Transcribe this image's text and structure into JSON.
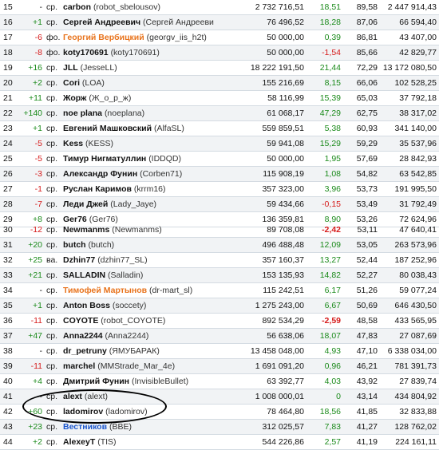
{
  "table_top": {
    "rows": [
      {
        "num": "15",
        "chg": "-",
        "chg_cls": "",
        "type": "ср.",
        "nick": "carbon",
        "nick_cls": "",
        "login": "(robot_sbelousov)",
        "amount": "2 732 716,51",
        "pct": "18,51",
        "pct_cls": "pos",
        "p2": "89,58",
        "total": "2 447 914,43"
      },
      {
        "num": "16",
        "chg": "+1",
        "chg_cls": "pos",
        "type": "ср.",
        "nick": "Сергей Андреевич",
        "nick_cls": "",
        "login": "(Сергей Андрееви",
        "amount": "76 496,52",
        "pct": "18,28",
        "pct_cls": "pos",
        "p2": "87,06",
        "total": "66 594,40"
      },
      {
        "num": "17",
        "chg": "-6",
        "chg_cls": "neg",
        "type": "фо.",
        "nick": "Георгий Вербицкий",
        "nick_cls": "orange",
        "login": "(georgv_iis_h2t)",
        "amount": "50 000,00",
        "pct": "0,39",
        "pct_cls": "pos",
        "p2": "86,81",
        "total": "43 407,00"
      },
      {
        "num": "18",
        "chg": "-8",
        "chg_cls": "neg",
        "type": "фо.",
        "nick": "koty170691",
        "nick_cls": "",
        "login": "(koty170691)",
        "amount": "50 000,00",
        "pct": "-1,54",
        "pct_cls": "neg",
        "p2": "85,66",
        "total": "42 829,77"
      },
      {
        "num": "19",
        "chg": "+16",
        "chg_cls": "pos",
        "type": "ср.",
        "nick": "JLL",
        "nick_cls": "",
        "login": "(JesseLL)",
        "amount": "18 222 191,50",
        "pct": "21,44",
        "pct_cls": "pos",
        "p2": "72,29",
        "total": "13 172 080,50"
      },
      {
        "num": "20",
        "chg": "+2",
        "chg_cls": "pos",
        "type": "ср.",
        "nick": "Cori",
        "nick_cls": "",
        "login": "(LOA)",
        "amount": "155 216,69",
        "pct": "8,15",
        "pct_cls": "pos",
        "p2": "66,06",
        "total": "102 528,25"
      },
      {
        "num": "21",
        "chg": "+11",
        "chg_cls": "pos",
        "type": "ср.",
        "nick": "Жорж",
        "nick_cls": "",
        "login": "(Ж_о_р_ж)",
        "amount": "58 116,99",
        "pct": "15,39",
        "pct_cls": "pos",
        "p2": "65,03",
        "total": "37 792,18"
      },
      {
        "num": "22",
        "chg": "+140",
        "chg_cls": "pos",
        "type": "ср.",
        "nick": "noe plana",
        "nick_cls": "",
        "login": "(noeplana)",
        "amount": "61 068,17",
        "pct": "47,29",
        "pct_cls": "pos",
        "p2": "62,75",
        "total": "38 317,02"
      },
      {
        "num": "23",
        "chg": "+1",
        "chg_cls": "pos",
        "type": "ср.",
        "nick": "Евгений Машковский",
        "nick_cls": "",
        "login": "(AlfaSL)",
        "amount": "559 859,51",
        "pct": "5,38",
        "pct_cls": "pos",
        "p2": "60,93",
        "total": "341 140,00"
      },
      {
        "num": "24",
        "chg": "-5",
        "chg_cls": "neg",
        "type": "ср.",
        "nick": "Kess",
        "nick_cls": "",
        "login": "(KESS)",
        "amount": "59 941,08",
        "pct": "15,29",
        "pct_cls": "pos",
        "p2": "59,29",
        "total": "35 537,96"
      },
      {
        "num": "25",
        "chg": "-5",
        "chg_cls": "neg",
        "type": "ср.",
        "nick": "Тимур Нигматуллин",
        "nick_cls": "",
        "login": "(IDDQD)",
        "amount": "50 000,00",
        "pct": "1,95",
        "pct_cls": "pos",
        "p2": "57,69",
        "total": "28 842,93"
      },
      {
        "num": "26",
        "chg": "-3",
        "chg_cls": "neg",
        "type": "ср.",
        "nick": "Александр Фунин",
        "nick_cls": "",
        "login": "(Corben71)",
        "amount": "115 908,19",
        "pct": "1,08",
        "pct_cls": "pos",
        "p2": "54,82",
        "total": "63 542,85"
      },
      {
        "num": "27",
        "chg": "-1",
        "chg_cls": "neg",
        "type": "ср.",
        "nick": "Руслан Каримов",
        "nick_cls": "",
        "login": "(krrm16)",
        "amount": "357 323,00",
        "pct": "3,96",
        "pct_cls": "pos",
        "p2": "53,73",
        "total": "191 995,50"
      },
      {
        "num": "28",
        "chg": "-7",
        "chg_cls": "neg",
        "type": "ср.",
        "nick": "Леди Джей",
        "nick_cls": "",
        "login": "(Lady_Jaye)",
        "amount": "59 434,66",
        "pct": "-0,15",
        "pct_cls": "neg",
        "p2": "53,49",
        "total": "31 792,49"
      },
      {
        "num": "29",
        "chg": "+8",
        "chg_cls": "pos",
        "type": "ср.",
        "nick": "Ger76",
        "nick_cls": "",
        "login": "(Ger76)",
        "amount": "136 359,81",
        "pct": "8,90",
        "pct_cls": "pos",
        "p2": "53,26",
        "total": "72 624,96"
      }
    ]
  },
  "table_bottom": {
    "rows": [
      {
        "num": "30",
        "chg": "-12",
        "chg_cls": "neg",
        "type": "ср.",
        "nick": "Newmanms",
        "nick_cls": "",
        "login": "(Newmanms)",
        "amount": "89 708,08",
        "pct": "-2,42",
        "pct_cls": "redb",
        "p2": "53,11",
        "total": "47 640,41"
      },
      {
        "num": "31",
        "chg": "+20",
        "chg_cls": "pos",
        "type": "ср.",
        "nick": "butch",
        "nick_cls": "",
        "login": "(butch)",
        "amount": "496 488,48",
        "pct": "12,09",
        "pct_cls": "pos",
        "p2": "53,05",
        "total": "263 573,96"
      },
      {
        "num": "32",
        "chg": "+25",
        "chg_cls": "pos",
        "type": "ва.",
        "nick": "Dzhin77",
        "nick_cls": "",
        "login": "(dzhin77_SL)",
        "amount": "357 160,37",
        "pct": "13,27",
        "pct_cls": "pos",
        "p2": "52,44",
        "total": "187 252,96"
      },
      {
        "num": "33",
        "chg": "+21",
        "chg_cls": "pos",
        "type": "ср.",
        "nick": "SALLADIN",
        "nick_cls": "",
        "login": "(Salladin)",
        "amount": "153 135,93",
        "pct": "14,82",
        "pct_cls": "pos",
        "p2": "52,27",
        "total": "80 038,43"
      },
      {
        "num": "34",
        "chg": "-",
        "chg_cls": "",
        "type": "ср.",
        "nick": "Тимофей Мартынов",
        "nick_cls": "orange",
        "login": "(dr-mart_sl)",
        "amount": "115 242,51",
        "pct": "6,17",
        "pct_cls": "pos",
        "p2": "51,26",
        "total": "59 077,24"
      },
      {
        "num": "35",
        "chg": "+1",
        "chg_cls": "pos",
        "type": "ср.",
        "nick": "Anton Boss",
        "nick_cls": "",
        "login": "(soccety)",
        "amount": "1 275 243,00",
        "pct": "6,67",
        "pct_cls": "pos",
        "p2": "50,69",
        "total": "646 430,50"
      },
      {
        "num": "36",
        "chg": "-11",
        "chg_cls": "neg",
        "type": "ср.",
        "nick": "COYOTE",
        "nick_cls": "",
        "login": "(robot_COYOTE)",
        "amount": "892 534,29",
        "pct": "-2,59",
        "pct_cls": "redb",
        "p2": "48,58",
        "total": "433 565,95"
      },
      {
        "num": "37",
        "chg": "+47",
        "chg_cls": "pos",
        "type": "ср.",
        "nick": "Anna2244",
        "nick_cls": "",
        "login": "(Anna2244)",
        "amount": "56 638,06",
        "pct": "18,07",
        "pct_cls": "pos",
        "p2": "47,83",
        "total": "27 087,69"
      },
      {
        "num": "38",
        "chg": "-",
        "chg_cls": "",
        "type": "ср.",
        "nick": "dr_petruny",
        "nick_cls": "",
        "login": "(ЯМУБАРАК)",
        "amount": "13 458 048,00",
        "pct": "4,93",
        "pct_cls": "pos",
        "p2": "47,10",
        "total": "6 338 034,00"
      },
      {
        "num": "39",
        "chg": "-11",
        "chg_cls": "neg",
        "type": "ср.",
        "nick": "marchel",
        "nick_cls": "",
        "login": "(MMStrade_Mar_4e)",
        "amount": "1 691 091,20",
        "pct": "0,96",
        "pct_cls": "pos",
        "p2": "46,21",
        "total": "781 391,73"
      },
      {
        "num": "40",
        "chg": "+4",
        "chg_cls": "pos",
        "type": "ср.",
        "nick": "Дмитрий Фунин",
        "nick_cls": "",
        "login": "(InvisibleBullet)",
        "amount": "63 392,77",
        "pct": "4,03",
        "pct_cls": "pos",
        "p2": "43,92",
        "total": "27 839,74"
      },
      {
        "num": "41",
        "chg": "-",
        "chg_cls": "",
        "type": "ср.",
        "nick": "alext",
        "nick_cls": "",
        "login": "(alext)",
        "amount": "1 008 000,01",
        "pct": "0",
        "pct_cls": "pos",
        "p2": "43,14",
        "total": "434 804,92"
      },
      {
        "num": "42",
        "chg": "+60",
        "chg_cls": "pos",
        "type": "ср.",
        "nick": "ladomirov",
        "nick_cls": "",
        "login": "(ladomirov)",
        "amount": "78 464,80",
        "pct": "18,56",
        "pct_cls": "pos",
        "p2": "41,85",
        "total": "32 833,88"
      },
      {
        "num": "43",
        "chg": "+23",
        "chg_cls": "pos",
        "type": "ср.",
        "nick": "Вестников",
        "nick_cls": "blue",
        "login": "(BBE)",
        "amount": "312 025,57",
        "pct": "7,83",
        "pct_cls": "pos",
        "p2": "41,27",
        "total": "128 762,02"
      },
      {
        "num": "44",
        "chg": "+2",
        "chg_cls": "pos",
        "type": "ср.",
        "nick": "AlexeyT",
        "nick_cls": "",
        "login": "(TIS)",
        "amount": "544 226,86",
        "pct": "2,57",
        "pct_cls": "pos",
        "p2": "41,19",
        "total": "224 161,11"
      }
    ]
  }
}
